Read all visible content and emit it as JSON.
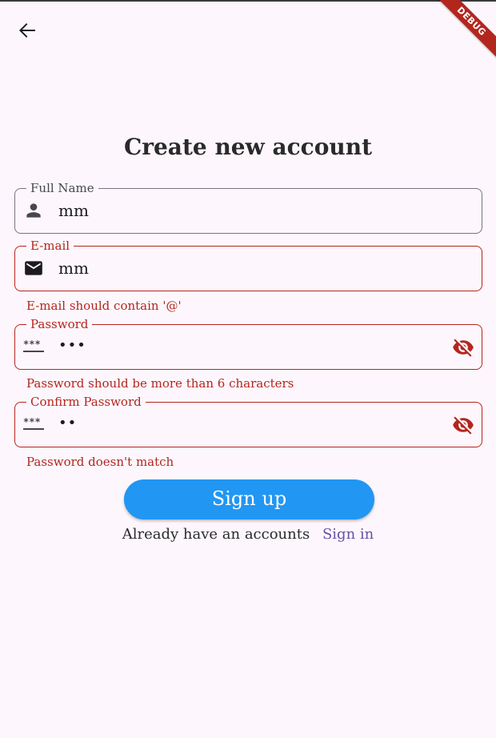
{
  "app": {
    "debug_banner": "DEBUG"
  },
  "page": {
    "title": "Create new account"
  },
  "form": {
    "full_name": {
      "label": "Full Name",
      "value": "mm",
      "icon": "person-icon"
    },
    "email": {
      "label": "E-mail",
      "value": "mm",
      "icon": "mail-icon",
      "error": "E-mail should contain '@'"
    },
    "password": {
      "label": "Password",
      "value": "•••",
      "icon": "password-icon",
      "toggle_icon": "visibility-off-icon",
      "error": "Password should be more than 6 characters"
    },
    "confirm_password": {
      "label": "Confirm Password",
      "value": "••",
      "icon": "password-icon",
      "toggle_icon": "visibility-off-icon",
      "error": "Password doesn't match"
    }
  },
  "actions": {
    "signup_label": "Sign up",
    "have_account_text": "Already have an accounts",
    "signin_label": "Sign in"
  },
  "colors": {
    "background": "#fdf7fd",
    "error": "#b3261e",
    "primary_button": "#2196f3",
    "link": "#6750a4"
  }
}
